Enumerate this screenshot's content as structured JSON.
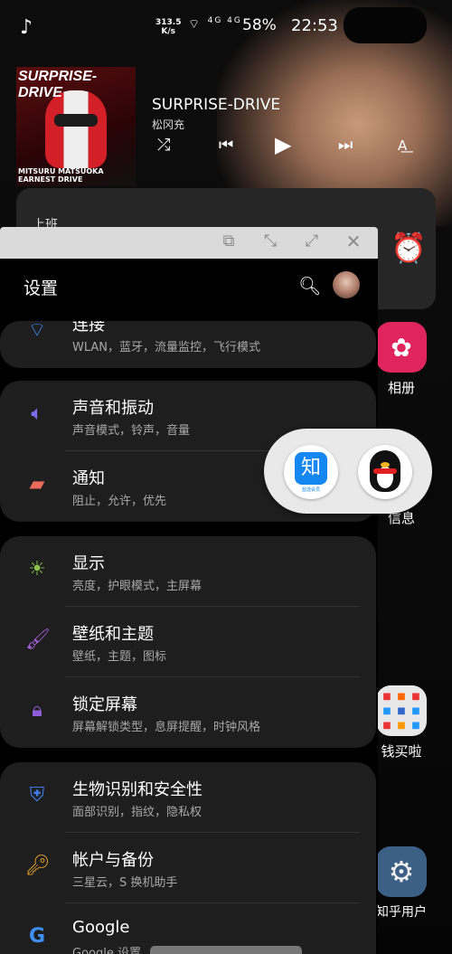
{
  "status_bar": {
    "speed": "313.5",
    "speed_unit": "K/s",
    "signal": "4G 4G",
    "battery": "58%",
    "time": "22:53"
  },
  "music": {
    "album_title": "SURPRISE-DRIVE",
    "album_sub": "MITSURU MATSUOKA  EARNEST DRIVE",
    "song": "SURPRISE-DRIVE",
    "artist": "松冈充"
  },
  "home": {
    "widget_label": "上班",
    "apps": [
      {
        "label": "相册"
      },
      {
        "label": "信息"
      },
      {
        "label": "钱买啦"
      },
      {
        "label": "知乎用户"
      }
    ]
  },
  "settings": {
    "title": "设置",
    "items": [
      {
        "title": "连接",
        "sub": "WLAN，蓝牙，流量监控，飞行模式",
        "icon": "wifi-icon",
        "color": "#3f8ff5"
      },
      {
        "title": "声音和振动",
        "sub": "声音模式，铃声，音量",
        "icon": "volume-icon",
        "color": "#7b6cf0"
      },
      {
        "title": "通知",
        "sub": "阻止，允许，优先",
        "icon": "notification-icon",
        "color": "#e96a5b"
      },
      {
        "title": "显示",
        "sub": "亮度，护眼模式，主屏幕",
        "icon": "brightness-icon",
        "color": "#8ac24a"
      },
      {
        "title": "壁纸和主题",
        "sub": "壁纸，主题，图标",
        "icon": "paintbrush-icon",
        "color": "#a35fd6"
      },
      {
        "title": "锁定屏幕",
        "sub": "屏幕解锁类型，息屏提醒，时钟风格",
        "icon": "lock-icon",
        "color": "#8e5fd6"
      },
      {
        "title": "生物识别和安全性",
        "sub": "面部识别，指纹，隐私权",
        "icon": "shield-icon",
        "color": "#3f7ee6"
      },
      {
        "title": "帐户与备份",
        "sub": "三星云，S 换机助手",
        "icon": "key-icon",
        "color": "#e9a32b"
      },
      {
        "title": "Google",
        "sub": "Google 设置",
        "icon": "google-icon",
        "color": "#3f8ff5"
      }
    ]
  },
  "bubble": {
    "zhihu_char": "知",
    "zhihu_sub": "盐选会员"
  }
}
